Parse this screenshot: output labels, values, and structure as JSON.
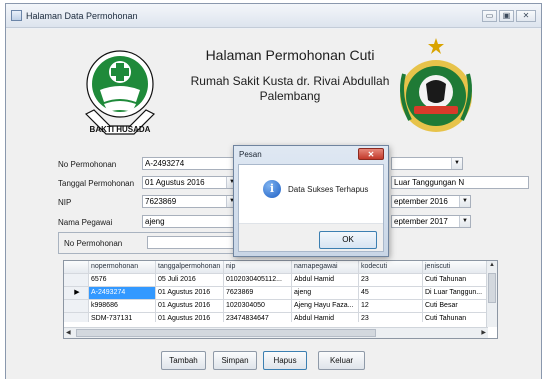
{
  "window": {
    "title": "Halaman Data Permohonan",
    "controls": {
      "minimize": "▭",
      "maximize": "▣",
      "close": "✕"
    }
  },
  "header": {
    "title": "Halaman Permohonan Cuti",
    "subtitle": "Rumah Sakit Kusta dr. Rivai Abdullah Palembang",
    "logo_left_text": "BAKTI HUSADA"
  },
  "form": {
    "no_permohonan": {
      "label": "No Permohonan",
      "value": "A-2493274"
    },
    "tanggal_permohonan": {
      "label": "Tanggal Permohonan",
      "day": "01",
      "month": "Agustus",
      "year": "2016"
    },
    "nip": {
      "label": "NIP",
      "value": "7623869"
    },
    "nama_pegawai": {
      "label": "Nama Pegawai",
      "value": "ajeng"
    },
    "jenis_cuti": {
      "value": "Luar Tanggungan N"
    },
    "tanggal_mulai": {
      "value": "eptember 2016"
    },
    "tanggal_selesai": {
      "value": "eptember 2017"
    },
    "search": {
      "label": "No Permohonan",
      "value": ""
    }
  },
  "grid": {
    "columns": [
      "nopermohonan",
      "tanggalpermohonan",
      "nip",
      "namapegawai",
      "kodecuti",
      "jeniscuti"
    ],
    "rows": [
      {
        "selected": false,
        "marker": "",
        "cells": [
          "6576",
          "05 Juli 2016",
          "0102030405112...",
          "Abdul Hamid",
          "23",
          "Cuti Tahunan"
        ]
      },
      {
        "selected": true,
        "marker": "▶",
        "cells": [
          "A-2493274",
          "01 Agustus 2016",
          "7623869",
          "ajeng",
          "45",
          "Di Luar Tanggun..."
        ]
      },
      {
        "selected": false,
        "marker": "",
        "cells": [
          "k998686",
          "01 Agustus 2016",
          "1020304050",
          "Ajeng Hayu Faza...",
          "12",
          "Cuti Besar"
        ]
      },
      {
        "selected": false,
        "marker": "",
        "cells": [
          "SDM-737131",
          "01 Agustus 2016",
          "23474834647",
          "Abdul Hamid",
          "23",
          "Cuti Tahunan"
        ]
      }
    ]
  },
  "buttons": {
    "tambah": "Tambah",
    "simpan": "Simpan",
    "hapus": "Hapus",
    "keluar": "Keluar"
  },
  "dialog": {
    "title": "Pesan",
    "message": "Data Sukses Terhapus",
    "ok": "OK",
    "close": "✕",
    "icon": "info-icon"
  },
  "colors": {
    "selection": "#3399ff",
    "logo_green": "#1f8a3a",
    "dialog_close": "#c2392a"
  }
}
